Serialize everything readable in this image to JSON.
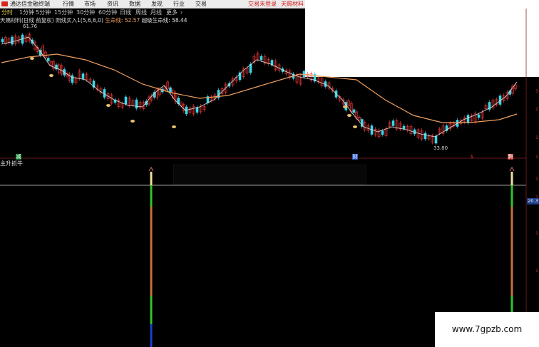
{
  "titlebar": {
    "app_name": "通达信金融终端",
    "menus": [
      "行情",
      "市场",
      "资讯",
      "数据",
      "发现",
      "行业",
      "交易"
    ],
    "login_label": "交易未登录",
    "stock_label": "天赐材料"
  },
  "periods": {
    "items": [
      "分时",
      "1分钟",
      "5分钟",
      "15分钟",
      "30分钟",
      "60分钟",
      "日线",
      "周线",
      "月线",
      "更多"
    ],
    "more_arrow": "›"
  },
  "main_chart": {
    "title": "天赐材料(日线 前复权)",
    "indicator_name": "阴线买入1(5,6,6,0)",
    "lifeline_label": "生命线: 52.57",
    "super_lifeline_label": "超级生命线: 58.44",
    "high_label": "61.76",
    "low_label": "33.80",
    "event_tags": [
      "减",
      "财",
      "$",
      "腾"
    ],
    "colors": {
      "up": "#ff3b3b",
      "down": "#38d8e8",
      "ma": "#e0e0e0",
      "lifeline": "#f0a060",
      "buy_marker": "#e8c070"
    }
  },
  "sub_chart": {
    "label": "主升抓牛",
    "ref_value": "20.3",
    "right_ticks": [
      "3",
      "2",
      "1",
      "1",
      "1",
      "1",
      "1",
      "1"
    ],
    "colors": {
      "arrow": "#d07070",
      "top": "#f0e0a0",
      "green": "#2ec52e",
      "orange": "#c8703a",
      "blue": "#1f3fc8"
    }
  },
  "watermark": "www.7gpzb.com"
}
